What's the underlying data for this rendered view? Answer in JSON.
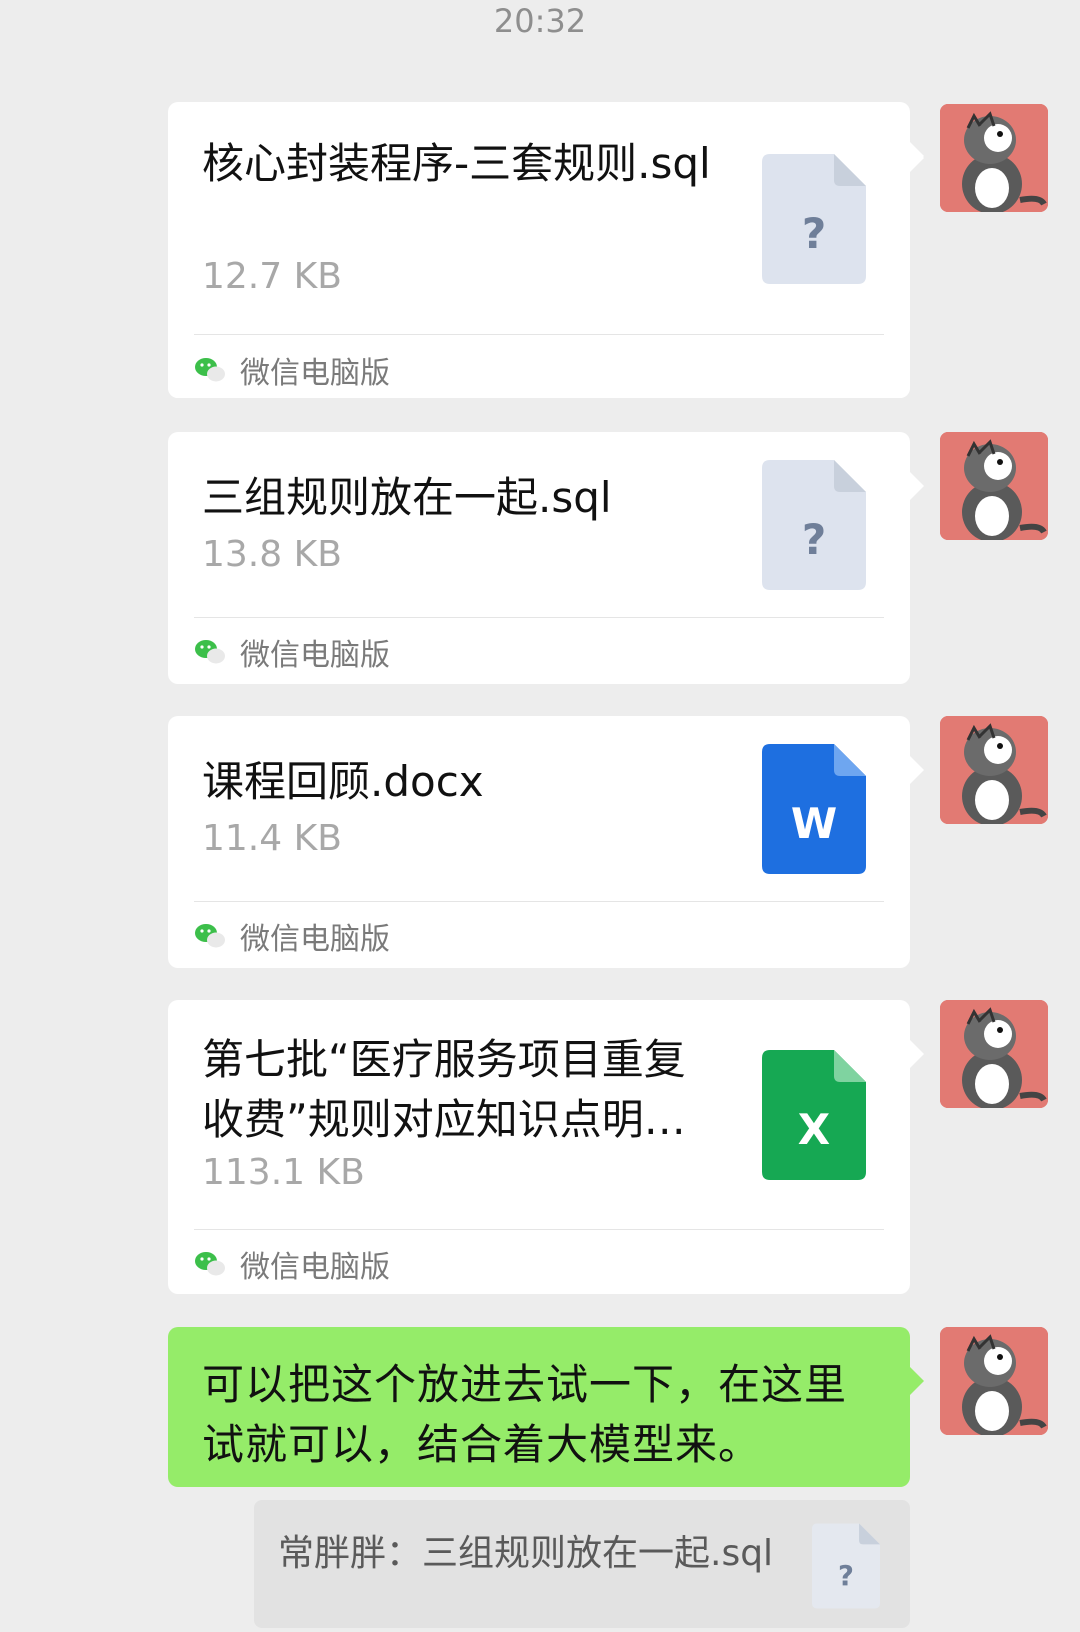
{
  "header": {
    "time": "20:32"
  },
  "messages": [
    {
      "type": "file",
      "name": "核心封装程序-三套规则.sql",
      "size": "12.7 KB",
      "icon": "unknown-file-icon",
      "icon_glyph": "?",
      "source": "微信电脑版"
    },
    {
      "type": "file",
      "name": "三组规则放在一起.sql",
      "size": "13.8 KB",
      "icon": "unknown-file-icon",
      "icon_glyph": "?",
      "source": "微信电脑版"
    },
    {
      "type": "file",
      "name": "课程回顾.docx",
      "size": "11.4 KB",
      "icon": "word-file-icon",
      "icon_glyph": "W",
      "source": "微信电脑版"
    },
    {
      "type": "file",
      "name": "第七批“医疗服务项目重复收费”规则对应知识点明…",
      "size": "113.1 KB",
      "icon": "excel-file-icon",
      "icon_glyph": "X",
      "source": "微信电脑版"
    },
    {
      "type": "text",
      "text": "可以把这个放进去试一下，在这里试就可以，结合着大模型来。"
    }
  ],
  "quote": {
    "text": "常胖胖：三组规则放在一起.sql",
    "icon_glyph": "?"
  },
  "colors": {
    "background": "#ededed",
    "bubble": "#ffffff",
    "sent_text_bubble": "#95ec69",
    "unknown_icon": "#dde3ee",
    "word_icon": "#1e6fe0",
    "excel_icon": "#16a853",
    "avatar_bg": "#e27a73"
  }
}
